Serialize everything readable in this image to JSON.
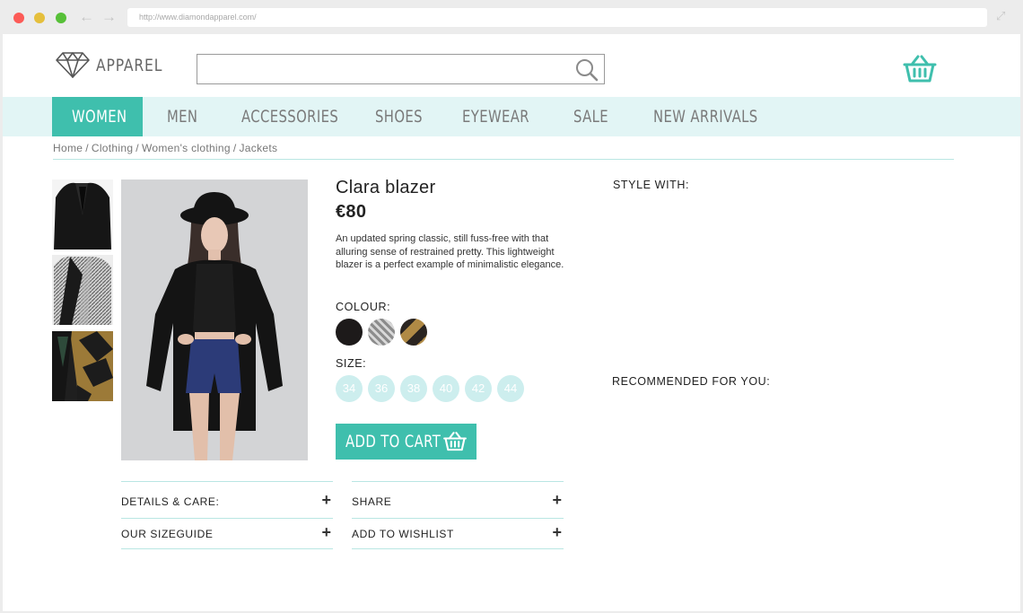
{
  "browser": {
    "url": "http://www.diamondapparel.com/"
  },
  "header": {
    "logo_text": "APPAREL",
    "search": {
      "placeholder": "",
      "value": ""
    }
  },
  "nav": {
    "items": [
      {
        "label": "WOMEN",
        "active": true
      },
      {
        "label": "MEN",
        "active": false
      },
      {
        "label": "ACCESSORIES",
        "active": false
      },
      {
        "label": "SHOES",
        "active": false
      },
      {
        "label": "EYEWEAR",
        "active": false
      },
      {
        "label": "SALE",
        "active": false
      },
      {
        "label": "NEW ARRIVALS",
        "active": false
      }
    ]
  },
  "breadcrumb": [
    "Home",
    "Clothing",
    "Women's clothing",
    "Jackets"
  ],
  "product": {
    "title": "Clara blazer",
    "price": "€80",
    "description": "An updated spring classic, still fuss-free with that alluring sense of restrained pretty. This lightweight blazer is a perfect example of minimalistic elegance.",
    "colour_label": "COLOUR:",
    "size_label": "SIZE:",
    "sizes": [
      "34",
      "36",
      "38",
      "40",
      "42",
      "44"
    ],
    "add_to_cart": "ADD TO CART"
  },
  "accordion": {
    "details": "DETAILS & CARE:",
    "share": "SHARE",
    "sizeguide": "OUR SIZEGUIDE",
    "wishlist": "ADD TO WISHLIST",
    "plus": "+"
  },
  "sidebar": {
    "style_with": "STYLE WITH:",
    "recommended": "RECOMMENDED FOR YOU:"
  },
  "colors": {
    "accent": "#3fbfad",
    "nav_bg": "#e2f5f5",
    "size_bubble": "#cdeeee"
  }
}
